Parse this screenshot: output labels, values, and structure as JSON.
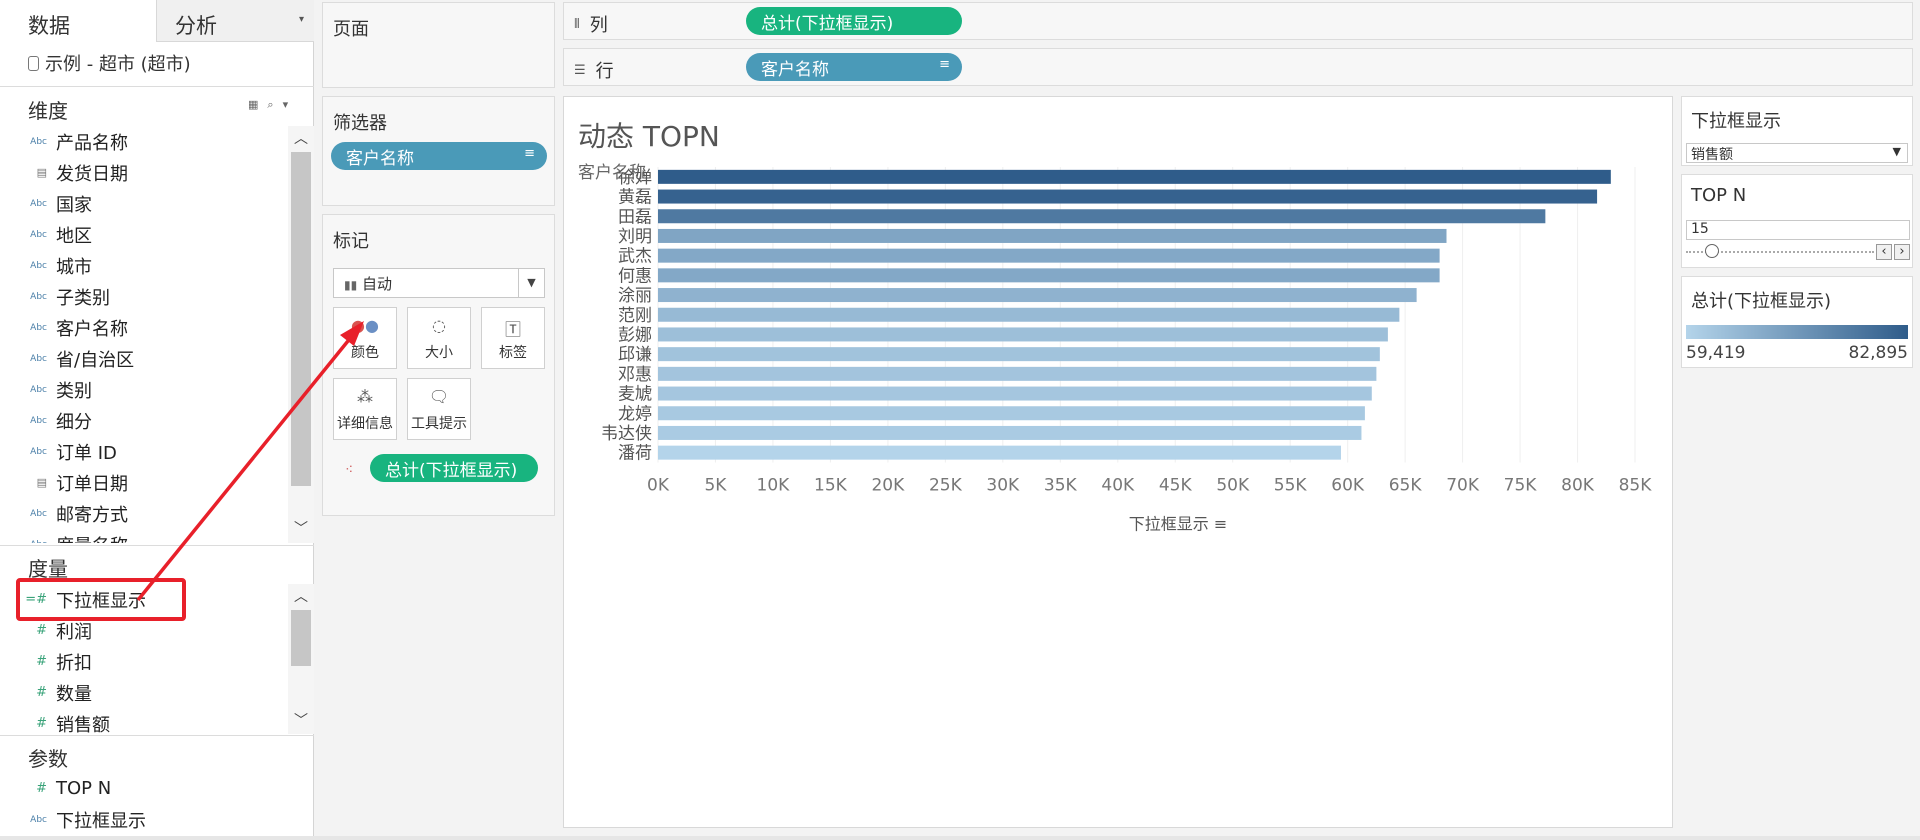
{
  "left_pane": {
    "tabs": {
      "data": "数据",
      "analysis": "分析"
    },
    "datasource": "示例 - 超市 (超市)",
    "dimensions_header": "维度",
    "dimensions": [
      {
        "icon": "Abc",
        "label": "产品名称"
      },
      {
        "icon": "date",
        "label": "发货日期"
      },
      {
        "icon": "Abc",
        "label": "国家"
      },
      {
        "icon": "Abc",
        "label": "地区"
      },
      {
        "icon": "Abc",
        "label": "城市"
      },
      {
        "icon": "Abc",
        "label": "子类别"
      },
      {
        "icon": "Abc",
        "label": "客户名称"
      },
      {
        "icon": "Abc",
        "label": "省/自治区"
      },
      {
        "icon": "Abc",
        "label": "类别"
      },
      {
        "icon": "Abc",
        "label": "细分"
      },
      {
        "icon": "Abc",
        "label": "订单 ID"
      },
      {
        "icon": "date",
        "label": "订单日期"
      },
      {
        "icon": "Abc",
        "label": "邮寄方式"
      },
      {
        "icon": "Abc",
        "label": "度量名称"
      }
    ],
    "measures_header": "度量",
    "measures": [
      {
        "icon": "=#",
        "label": "下拉框显示"
      },
      {
        "icon": "#",
        "label": "利润"
      },
      {
        "icon": "#",
        "label": "折扣"
      },
      {
        "icon": "#",
        "label": "数量"
      },
      {
        "icon": "#",
        "label": "销售额"
      }
    ],
    "parameters_header": "参数",
    "parameters": [
      {
        "icon": "#",
        "label": "TOP N"
      },
      {
        "icon": "Abc",
        "label": "下拉框显示"
      }
    ]
  },
  "pages_card": {
    "title": "页面"
  },
  "filters_card": {
    "title": "筛选器",
    "pill": "客户名称"
  },
  "marks_card": {
    "title": "标记",
    "mark_type": "自动",
    "buttons": [
      "颜色",
      "大小",
      "标签",
      "详细信息",
      "工具提示"
    ],
    "pill": "总计(下拉框显示)"
  },
  "shelves": {
    "columns_label": "列",
    "columns_pill": "总计(下拉框显示)",
    "rows_label": "行",
    "rows_pill": "客户名称"
  },
  "viz": {
    "title": "动态 TOPN",
    "row_header": "客户名称",
    "x_axis_title": "下拉框显示"
  },
  "chart_data": {
    "type": "bar",
    "orientation": "horizontal",
    "title": "动态 TOPN",
    "categories": [
      "徐婵",
      "黄磊",
      "田磊",
      "刘明",
      "武杰",
      "何惠",
      "涂丽",
      "范刚",
      "彭娜",
      "邱谦",
      "邓惠",
      "麦虓",
      "龙婷",
      "韦达侠",
      "潘荷"
    ],
    "values": [
      82895,
      81700,
      77200,
      68600,
      68000,
      68000,
      66000,
      64500,
      63500,
      62800,
      62500,
      62100,
      61500,
      61200,
      59419
    ],
    "xlabel": "下拉框显示",
    "ylabel": "客户名称",
    "xlim": [
      0,
      87000
    ],
    "x_ticks": [
      0,
      5000,
      10000,
      15000,
      20000,
      25000,
      30000,
      35000,
      40000,
      45000,
      50000,
      55000,
      60000,
      65000,
      70000,
      75000,
      80000,
      85000
    ],
    "x_tick_labels": [
      "0K",
      "5K",
      "10K",
      "15K",
      "20K",
      "25K",
      "30K",
      "35K",
      "40K",
      "45K",
      "50K",
      "55K",
      "60K",
      "65K",
      "70K",
      "75K",
      "80K",
      "85K"
    ],
    "grid": true,
    "color_low": "#b4d4ea",
    "color_high": "#2f5c8a"
  },
  "right_pane": {
    "dropdown_card": {
      "title": "下拉框显示",
      "selected": "销售额"
    },
    "topn_card": {
      "title": "TOP N",
      "value": "15",
      "slider_fraction": 0.14
    },
    "legend_card": {
      "title": "总计(下拉框显示)",
      "min": "59,419",
      "max": "82,895"
    }
  },
  "colors": {
    "blue_pill": "#4a9ab8",
    "green_pill": "#18b47f",
    "highlight": "#e8202a",
    "arrow": "#e8202a"
  }
}
